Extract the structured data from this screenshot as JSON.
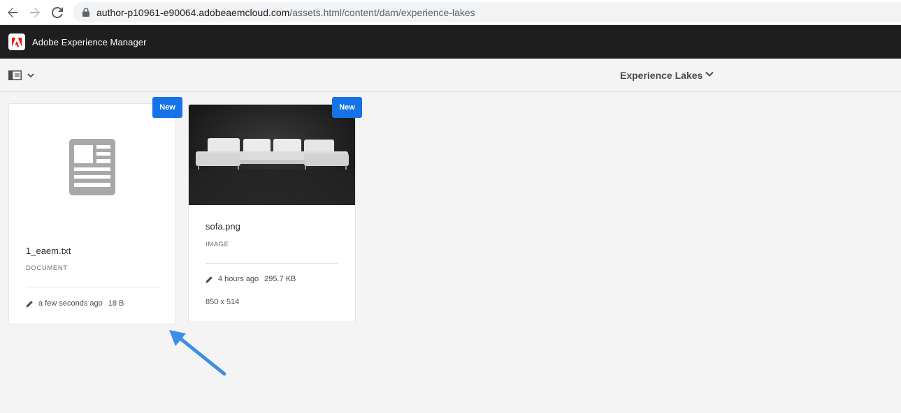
{
  "browser": {
    "url_host": "author-p10961-e90064.adobeaemcloud.com",
    "url_path": "/assets.html/content/dam/experience-lakes"
  },
  "header": {
    "app_title": "Adobe Experience Manager"
  },
  "action_bar": {
    "folder_title": "Experience Lakes"
  },
  "assets": [
    {
      "badge": "New",
      "name": "1_eaem.txt",
      "type": "DOCUMENT",
      "modified": "a few seconds ago",
      "size": "18 B"
    },
    {
      "badge": "New",
      "name": "sofa.png",
      "type": "IMAGE",
      "modified": "4 hours ago",
      "size": "295.7 KB",
      "dimensions": "850 x 514"
    }
  ],
  "colors": {
    "accent": "#1473e6",
    "header_bg": "#1e1e1e",
    "adobe_red": "#eb1000",
    "annotation_arrow": "#3d8ee8"
  }
}
